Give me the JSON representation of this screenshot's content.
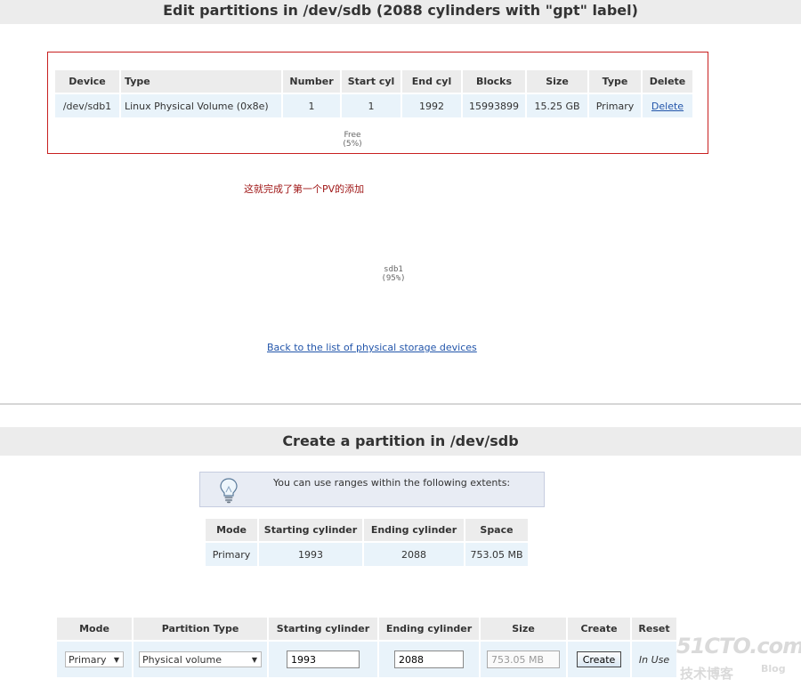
{
  "edit_section": {
    "title": "Edit partitions in /dev/sdb (2088 cylinders with \"gpt\" label)",
    "columns": [
      "Device",
      "Type",
      "Number",
      "Start cyl",
      "End cyl",
      "Blocks",
      "Size",
      "Type",
      "Delete"
    ],
    "rows": [
      {
        "device": "/dev/sdb1",
        "type": "Linux Physical Volume (0x8e)",
        "number": "1",
        "start_cyl": "1",
        "end_cyl": "1992",
        "blocks": "15993899",
        "size": "15.25 GB",
        "ptype": "Primary",
        "delete": "Delete"
      }
    ],
    "free_label": "Free",
    "free_pct": "(5%)"
  },
  "annotation_note": "这就完成了第一个PV的添加",
  "chart_labels": {
    "sdb1_label": "sdb1",
    "sdb1_pct": "(95%)"
  },
  "back_link": "Back to the list of physical storage devices",
  "create_section": {
    "title": "Create a partition in /dev/sdb",
    "hint": "You can use ranges within the following extents:",
    "extents_columns": [
      "Mode",
      "Starting cylinder",
      "Ending cylinder",
      "Space"
    ],
    "extents_rows": [
      {
        "mode": "Primary",
        "start": "1993",
        "end": "2088",
        "space": "753.05 MB"
      }
    ],
    "form_columns": [
      "Mode",
      "Partition Type",
      "Starting cylinder",
      "Ending cylinder",
      "Size",
      "Create",
      "Reset"
    ],
    "form": {
      "mode": "Primary",
      "partition_type": "Physical volume",
      "start": "1993",
      "end": "2088",
      "size": "753.05 MB",
      "create_label": "Create",
      "reset_label": "In Use"
    }
  },
  "watermark": {
    "logo": "51CTO.com",
    "cn": "技术博客",
    "blog": "Blog"
  }
}
